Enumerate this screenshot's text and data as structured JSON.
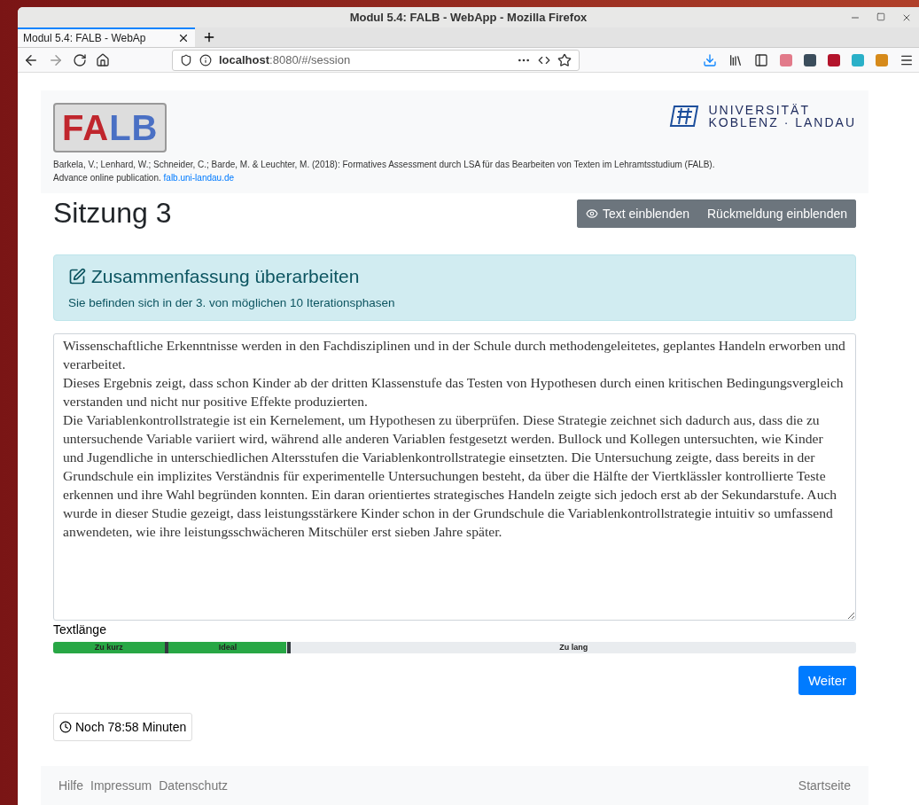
{
  "window": {
    "title": "Modul 5.4: FALB - WebApp - Mozilla Firefox"
  },
  "tabs": [
    {
      "label": "Modul 5.4: FALB - WebAp",
      "selected": true
    }
  ],
  "address": {
    "host": "localhost",
    "rest": ":8080/#/session"
  },
  "header": {
    "logo": [
      {
        "text": "FA",
        "color": "#c0262d"
      },
      {
        "text": "LB",
        "color": "#4a70c4"
      }
    ],
    "university": [
      "UNIVERSITÄT",
      "KOBLENZ · LANDAU"
    ],
    "citation": "Barkela, V.; Lenhard, W.; Schneider, C.; Barde, M. & Leuchter, M. (2018): Formatives Assessment durch LSA für das Bearbeiten von Texten im Lehramtsstudium (FALB).",
    "citation_tail": "Advance online publication.",
    "link": "falb.uni-landau.de"
  },
  "page_title": "Sitzung 3",
  "toggles": [
    {
      "label": "Text einblenden",
      "icon": true
    },
    {
      "label": "Rückmeldung einblenden",
      "icon": false
    }
  ],
  "task": {
    "title": "Zusammenfassung überarbeiten",
    "subtitle": "Sie befinden sich in der 3. von möglichen 10 Iterationsphasen"
  },
  "summary": "Wissenschaftliche Erkenntnisse werden in den Fachdisziplinen und in der Schule durch methodengeleitetes, geplantes Handeln erworben und verarbeitet.\nDieses Ergebnis zeigt, dass schon Kinder ab der dritten Klassenstufe das Testen von Hypothesen durch einen kritischen Bedingungsvergleich verstanden und nicht nur positive Effekte produzierten.\nDie Variablenkontrollstrategie ist ein Kernelement, um Hypothesen zu überprüfen. Diese Strategie zeichnet sich dadurch aus, dass die zu untersuchende Variable variiert wird, während alle anderen Variablen festgesetzt werden. Bullock und Kollegen untersuchten, wie Kinder und Jugendliche in unterschiedlichen Altersstufen die Variablenkontrollstrategie einsetzten. Die Untersuchung zeigte, dass bereits in der Grundschule ein implizites Verständnis für experimentelle Untersuchungen besteht, da über die Hälfte der Viertklässler kontrollierte Teste erkennen und ihre Wahl begründen konnten. Ein daran orientiertes strategisches Handeln zeigte sich jedoch erst ab der Sekundarstufe. Auch wurde in dieser Studie gezeigt, dass leistungsstärkere Kinder schon in der Grundschule die Variablenkontrollstrategie intuitiv so umfassend anwendeten, wie ihre leistungsschwächeren Mitschüler erst sieben Jahre später.",
  "length": {
    "label": "Textlänge",
    "level": 0.29,
    "segments": [
      "Zu kurz",
      "Ideal",
      "Zu lang"
    ]
  },
  "next_button": "Weiter",
  "timer": "Noch 78:58 Minuten",
  "footer": {
    "links": [
      "Hilfe",
      "Impressum",
      "Datenschutz"
    ],
    "right": "Startseite"
  }
}
